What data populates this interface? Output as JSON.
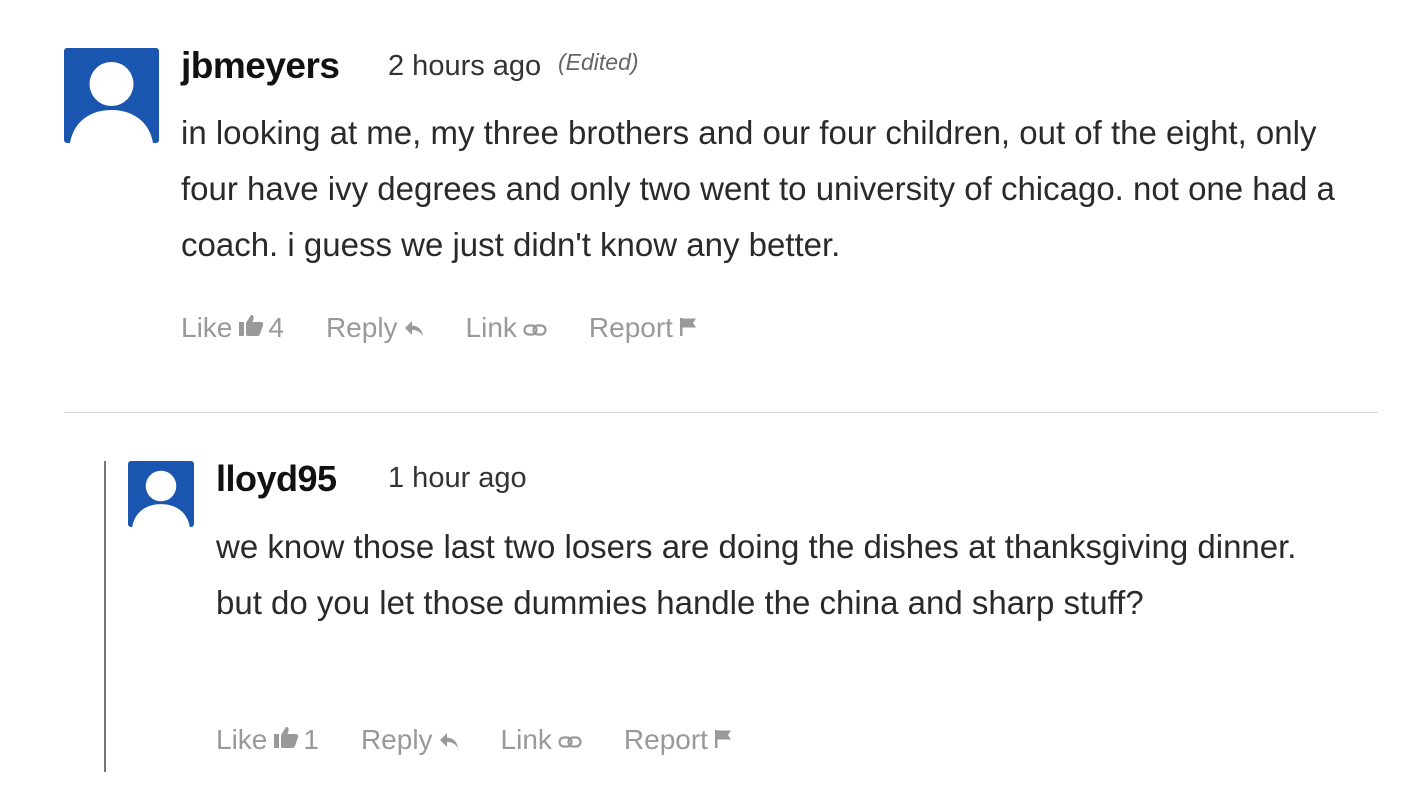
{
  "comments": [
    {
      "username": "jbmeyers",
      "time": "2 hours ago",
      "edited": "(Edited)",
      "body": "in looking at me, my three brothers and our four children, out of the eight, only four have ivy degrees and only two went to university of chicago. not one had a coach. i guess we just didn't know any better.",
      "actions": {
        "like": "Like",
        "like_count": "4",
        "reply": "Reply",
        "link": "Link",
        "report": "Report"
      },
      "avatar_color": "#1a56b0"
    },
    {
      "username": "lloyd95",
      "time": "1 hour ago",
      "body": "we know those last two losers are doing the dishes at thanksgiving dinner.  but do you let those dummies handle the china and sharp stuff?",
      "actions": {
        "like": "Like",
        "like_count": "1",
        "reply": "Reply",
        "link": "Link",
        "report": "Report"
      },
      "avatar_color": "#1a56b0"
    }
  ],
  "icons": [
    "thumbs-up-icon",
    "reply-arrow-icon",
    "link-icon",
    "flag-icon"
  ]
}
